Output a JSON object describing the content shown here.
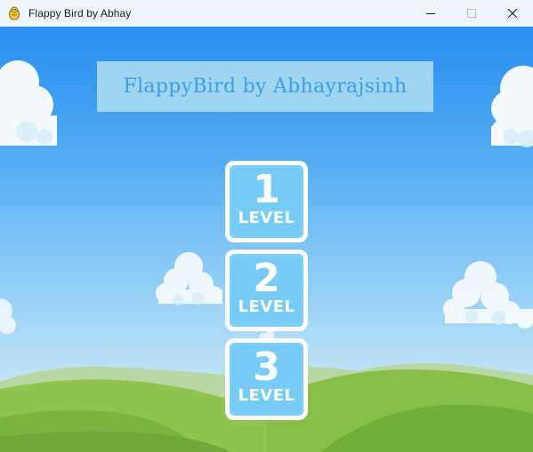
{
  "window": {
    "title": "Flappy Bird by Abhay",
    "icon": "pygame-snake-icon",
    "controls": [
      "minimize-icon",
      "maximize-icon",
      "close-icon"
    ]
  },
  "game": {
    "banner_title": "FlappyBird by Abhayrajsinh",
    "colors": {
      "banner_text": "#3a9ee8",
      "banner_bg": "#b6e2f0",
      "button_fill": "#76ccf6",
      "button_border": "#ffffff"
    },
    "levels": [
      {
        "number": "1",
        "label": "LEVEL"
      },
      {
        "number": "2",
        "label": "LEVEL"
      },
      {
        "number": "3",
        "label": "LEVEL"
      }
    ]
  }
}
